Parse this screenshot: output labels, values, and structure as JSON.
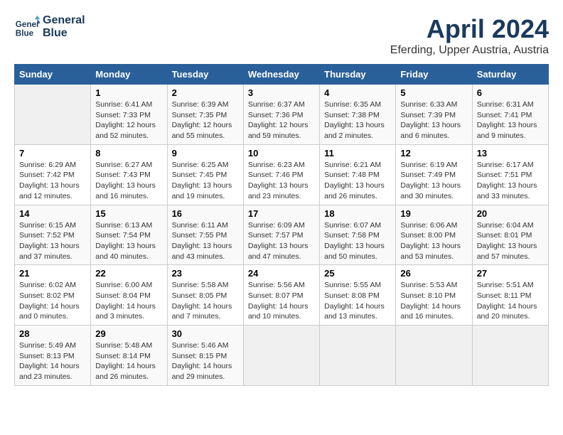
{
  "header": {
    "logo_line1": "General",
    "logo_line2": "Blue",
    "month_year": "April 2024",
    "location": "Eferding, Upper Austria, Austria"
  },
  "weekdays": [
    "Sunday",
    "Monday",
    "Tuesday",
    "Wednesday",
    "Thursday",
    "Friday",
    "Saturday"
  ],
  "weeks": [
    [
      {
        "day": "",
        "empty": true
      },
      {
        "day": "1",
        "sunrise": "Sunrise: 6:41 AM",
        "sunset": "Sunset: 7:33 PM",
        "daylight": "Daylight: 12 hours and 52 minutes."
      },
      {
        "day": "2",
        "sunrise": "Sunrise: 6:39 AM",
        "sunset": "Sunset: 7:35 PM",
        "daylight": "Daylight: 12 hours and 55 minutes."
      },
      {
        "day": "3",
        "sunrise": "Sunrise: 6:37 AM",
        "sunset": "Sunset: 7:36 PM",
        "daylight": "Daylight: 12 hours and 59 minutes."
      },
      {
        "day": "4",
        "sunrise": "Sunrise: 6:35 AM",
        "sunset": "Sunset: 7:38 PM",
        "daylight": "Daylight: 13 hours and 2 minutes."
      },
      {
        "day": "5",
        "sunrise": "Sunrise: 6:33 AM",
        "sunset": "Sunset: 7:39 PM",
        "daylight": "Daylight: 13 hours and 6 minutes."
      },
      {
        "day": "6",
        "sunrise": "Sunrise: 6:31 AM",
        "sunset": "Sunset: 7:41 PM",
        "daylight": "Daylight: 13 hours and 9 minutes."
      }
    ],
    [
      {
        "day": "7",
        "sunrise": "Sunrise: 6:29 AM",
        "sunset": "Sunset: 7:42 PM",
        "daylight": "Daylight: 13 hours and 12 minutes."
      },
      {
        "day": "8",
        "sunrise": "Sunrise: 6:27 AM",
        "sunset": "Sunset: 7:43 PM",
        "daylight": "Daylight: 13 hours and 16 minutes."
      },
      {
        "day": "9",
        "sunrise": "Sunrise: 6:25 AM",
        "sunset": "Sunset: 7:45 PM",
        "daylight": "Daylight: 13 hours and 19 minutes."
      },
      {
        "day": "10",
        "sunrise": "Sunrise: 6:23 AM",
        "sunset": "Sunset: 7:46 PM",
        "daylight": "Daylight: 13 hours and 23 minutes."
      },
      {
        "day": "11",
        "sunrise": "Sunrise: 6:21 AM",
        "sunset": "Sunset: 7:48 PM",
        "daylight": "Daylight: 13 hours and 26 minutes."
      },
      {
        "day": "12",
        "sunrise": "Sunrise: 6:19 AM",
        "sunset": "Sunset: 7:49 PM",
        "daylight": "Daylight: 13 hours and 30 minutes."
      },
      {
        "day": "13",
        "sunrise": "Sunrise: 6:17 AM",
        "sunset": "Sunset: 7:51 PM",
        "daylight": "Daylight: 13 hours and 33 minutes."
      }
    ],
    [
      {
        "day": "14",
        "sunrise": "Sunrise: 6:15 AM",
        "sunset": "Sunset: 7:52 PM",
        "daylight": "Daylight: 13 hours and 37 minutes."
      },
      {
        "day": "15",
        "sunrise": "Sunrise: 6:13 AM",
        "sunset": "Sunset: 7:54 PM",
        "daylight": "Daylight: 13 hours and 40 minutes."
      },
      {
        "day": "16",
        "sunrise": "Sunrise: 6:11 AM",
        "sunset": "Sunset: 7:55 PM",
        "daylight": "Daylight: 13 hours and 43 minutes."
      },
      {
        "day": "17",
        "sunrise": "Sunrise: 6:09 AM",
        "sunset": "Sunset: 7:57 PM",
        "daylight": "Daylight: 13 hours and 47 minutes."
      },
      {
        "day": "18",
        "sunrise": "Sunrise: 6:07 AM",
        "sunset": "Sunset: 7:58 PM",
        "daylight": "Daylight: 13 hours and 50 minutes."
      },
      {
        "day": "19",
        "sunrise": "Sunrise: 6:06 AM",
        "sunset": "Sunset: 8:00 PM",
        "daylight": "Daylight: 13 hours and 53 minutes."
      },
      {
        "day": "20",
        "sunrise": "Sunrise: 6:04 AM",
        "sunset": "Sunset: 8:01 PM",
        "daylight": "Daylight: 13 hours and 57 minutes."
      }
    ],
    [
      {
        "day": "21",
        "sunrise": "Sunrise: 6:02 AM",
        "sunset": "Sunset: 8:02 PM",
        "daylight": "Daylight: 14 hours and 0 minutes."
      },
      {
        "day": "22",
        "sunrise": "Sunrise: 6:00 AM",
        "sunset": "Sunset: 8:04 PM",
        "daylight": "Daylight: 14 hours and 3 minutes."
      },
      {
        "day": "23",
        "sunrise": "Sunrise: 5:58 AM",
        "sunset": "Sunset: 8:05 PM",
        "daylight": "Daylight: 14 hours and 7 minutes."
      },
      {
        "day": "24",
        "sunrise": "Sunrise: 5:56 AM",
        "sunset": "Sunset: 8:07 PM",
        "daylight": "Daylight: 14 hours and 10 minutes."
      },
      {
        "day": "25",
        "sunrise": "Sunrise: 5:55 AM",
        "sunset": "Sunset: 8:08 PM",
        "daylight": "Daylight: 14 hours and 13 minutes."
      },
      {
        "day": "26",
        "sunrise": "Sunrise: 5:53 AM",
        "sunset": "Sunset: 8:10 PM",
        "daylight": "Daylight: 14 hours and 16 minutes."
      },
      {
        "day": "27",
        "sunrise": "Sunrise: 5:51 AM",
        "sunset": "Sunset: 8:11 PM",
        "daylight": "Daylight: 14 hours and 20 minutes."
      }
    ],
    [
      {
        "day": "28",
        "sunrise": "Sunrise: 5:49 AM",
        "sunset": "Sunset: 8:13 PM",
        "daylight": "Daylight: 14 hours and 23 minutes."
      },
      {
        "day": "29",
        "sunrise": "Sunrise: 5:48 AM",
        "sunset": "Sunset: 8:14 PM",
        "daylight": "Daylight: 14 hours and 26 minutes."
      },
      {
        "day": "30",
        "sunrise": "Sunrise: 5:46 AM",
        "sunset": "Sunset: 8:15 PM",
        "daylight": "Daylight: 14 hours and 29 minutes."
      },
      {
        "day": "",
        "empty": true
      },
      {
        "day": "",
        "empty": true
      },
      {
        "day": "",
        "empty": true
      },
      {
        "day": "",
        "empty": true
      }
    ]
  ]
}
